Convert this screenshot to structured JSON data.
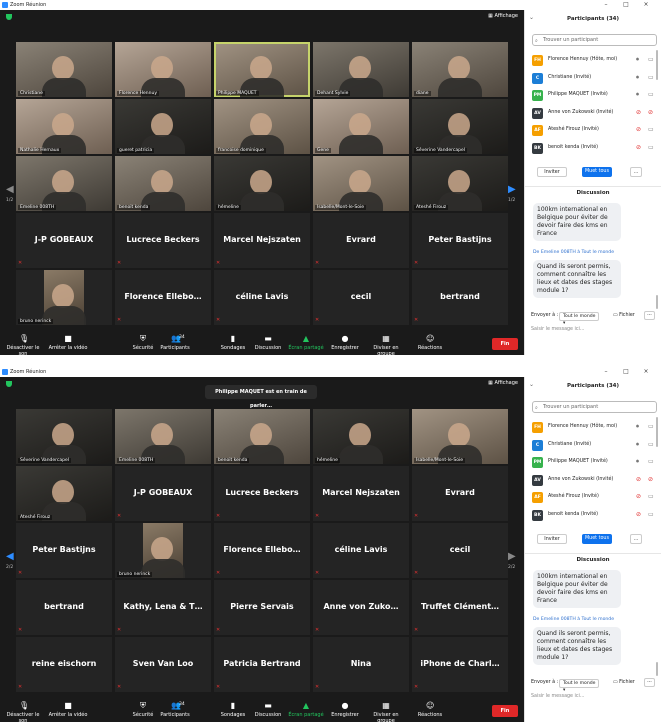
{
  "window_title": "Zoom Réunion",
  "view_label": "Affichage",
  "speaking_banner": "Philippe MAQUET est en train de parler…",
  "end_label": "Fin",
  "page_indicators": {
    "w1_left": "1/2",
    "w1_right": "1/2",
    "w2_left": "2/2",
    "w2_right": "2/2"
  },
  "toolbar": [
    {
      "id": "audio",
      "label": "Désactiver le son",
      "icon": "microphone-icon"
    },
    {
      "id": "video",
      "label": "Arrêter la vidéo",
      "icon": "camera-icon"
    },
    {
      "id": "security",
      "label": "Sécurité",
      "icon": "shield-icon"
    },
    {
      "id": "participants",
      "label": "Participants",
      "icon": "people-icon",
      "badge": "34"
    },
    {
      "id": "polls",
      "label": "Sondages",
      "icon": "bar-chart-icon"
    },
    {
      "id": "chat",
      "label": "Discussion",
      "icon": "chat-icon"
    },
    {
      "id": "share",
      "label": "Écran partagé",
      "icon": "share-icon"
    },
    {
      "id": "record",
      "label": "Enregistrer",
      "icon": "record-icon"
    },
    {
      "id": "breakout",
      "label": "Diviser en groupe",
      "icon": "grid-icon"
    },
    {
      "id": "reactions",
      "label": "Réactions",
      "icon": "emoji-icon"
    }
  ],
  "window1_tiles": [
    {
      "name": "Christiane",
      "cam": true,
      "shade": 0
    },
    {
      "name": "Florence Hennuy",
      "cam": true,
      "shade": 1
    },
    {
      "name": "Philippe MAQUET",
      "cam": true,
      "shade": 3,
      "active": true
    },
    {
      "name": "Dehant Sylvie",
      "cam": true,
      "shade": 4
    },
    {
      "name": "diane",
      "cam": true,
      "shade": 0
    },
    {
      "name": "Nathalie Hernaux",
      "cam": true,
      "shade": 1
    },
    {
      "name": "gueret patricia",
      "cam": true,
      "shade": 2
    },
    {
      "name": "francoise dominique",
      "cam": true,
      "shade": 3
    },
    {
      "name": "Gene",
      "cam": true,
      "shade": 1
    },
    {
      "name": "Séverine Vandercapel",
      "cam": true,
      "shade": 2
    },
    {
      "name": "Emeline 008TH",
      "cam": true,
      "shade": 4
    },
    {
      "name": "benoit kenda",
      "cam": true,
      "shade": 0
    },
    {
      "name": "hémeline",
      "cam": true,
      "shade": 2
    },
    {
      "name": "Isabelle/Mont-le-Soie",
      "cam": true,
      "shade": 3
    },
    {
      "name": "Ateshé Firouz",
      "cam": true,
      "shade": 2
    },
    {
      "name": "J-P GOBEAUX",
      "cam": false
    },
    {
      "name": "Lucrece Beckers",
      "cam": false
    },
    {
      "name": "Marcel Nejszaten",
      "cam": false
    },
    {
      "name": "Evrard",
      "cam": false
    },
    {
      "name": "Peter Bastijns",
      "cam": false
    },
    {
      "name": "bruno nerinck",
      "cam": true,
      "shade": 3,
      "small": true
    },
    {
      "name": "Florence  Ellebo…",
      "cam": false
    },
    {
      "name": "céline Lavis",
      "cam": false
    },
    {
      "name": "cecil",
      "cam": false
    },
    {
      "name": "bertrand",
      "cam": false
    }
  ],
  "window2_tiles": [
    {
      "name": "Séverine Vandercapel",
      "cam": true,
      "shade": 2
    },
    {
      "name": "Emeline 008TH",
      "cam": true,
      "shade": 4
    },
    {
      "name": "benoit kenda",
      "cam": true,
      "shade": 0
    },
    {
      "name": "hémeline",
      "cam": true,
      "shade": 2
    },
    {
      "name": "Isabelle/Mont-le-Soie",
      "cam": true,
      "shade": 3
    },
    {
      "name": "Ateshé Firouz",
      "cam": true,
      "shade": 2
    },
    {
      "name": "J-P GOBEAUX",
      "cam": false
    },
    {
      "name": "Lucrece Beckers",
      "cam": false
    },
    {
      "name": "Marcel Nejszaten",
      "cam": false
    },
    {
      "name": "Evrard",
      "cam": false
    },
    {
      "name": "Peter Bastijns",
      "cam": false
    },
    {
      "name": "bruno nerinck",
      "cam": true,
      "shade": 3,
      "small": true
    },
    {
      "name": "Florence  Ellebo…",
      "cam": false
    },
    {
      "name": "céline Lavis",
      "cam": false
    },
    {
      "name": "cecil",
      "cam": false
    },
    {
      "name": "bertrand",
      "cam": false
    },
    {
      "name": "Kathy, Lena & T…",
      "cam": false
    },
    {
      "name": "Pierre Servais",
      "cam": false
    },
    {
      "name": "Anne von Zuko…",
      "cam": false
    },
    {
      "name": "Truffet  Clément…",
      "cam": false
    },
    {
      "name": "reine eischorn",
      "cam": false
    },
    {
      "name": "Sven Van Loo",
      "cam": false
    },
    {
      "name": "Patricia Bertrand",
      "cam": false
    },
    {
      "name": "Nina",
      "cam": false
    },
    {
      "name": "iPhone de Charl…",
      "cam": false
    }
  ],
  "panel": {
    "title": "Participants (34)",
    "search_placeholder": "Trouver un participant",
    "participants": [
      {
        "initials": "FH",
        "name": "Florence Hennuy (Hôte, moi)",
        "color": "#f59f00",
        "mic_off": false,
        "cam_off": false
      },
      {
        "initials": "C",
        "name": "Christiane (Invité)",
        "color": "#1c7ed6",
        "mic_off": false,
        "cam_off": false
      },
      {
        "initials": "PM",
        "name": "Philippe MAQUET (Invité)",
        "color": "#37b24d",
        "mic_off": false,
        "cam_off": false
      },
      {
        "initials": "AV",
        "name": "Anne von Zukowski (Invité)",
        "color": "#343a40",
        "mic_off": true,
        "cam_off": true
      },
      {
        "initials": "AF",
        "name": "Ateshé Firouz (Invité)",
        "color": "#f59f00",
        "mic_off": true,
        "cam_off": false
      },
      {
        "initials": "BK",
        "name": "benoit kenda (Invité)",
        "color": "#343a40",
        "mic_off": true,
        "cam_off": false
      }
    ],
    "invite_label": "Inviter",
    "mute_all_label": "Muet tous",
    "more_label": "...",
    "chat_title": "Discussion",
    "msg1": "100km international en Belgique pour éviter de devoir faire des kms en France",
    "msg_from": "De Emeline 008TH à Tout le monde",
    "msg2": "Quand ils seront permis, comment connaître les lieux et dates des stages module 1?",
    "send_to_label": "Envoyer à :",
    "send_to_value": "Tout le monde",
    "file_label": "Fichier",
    "chat_more": "···",
    "chat_input_placeholder": "Saisir le message ici..."
  }
}
